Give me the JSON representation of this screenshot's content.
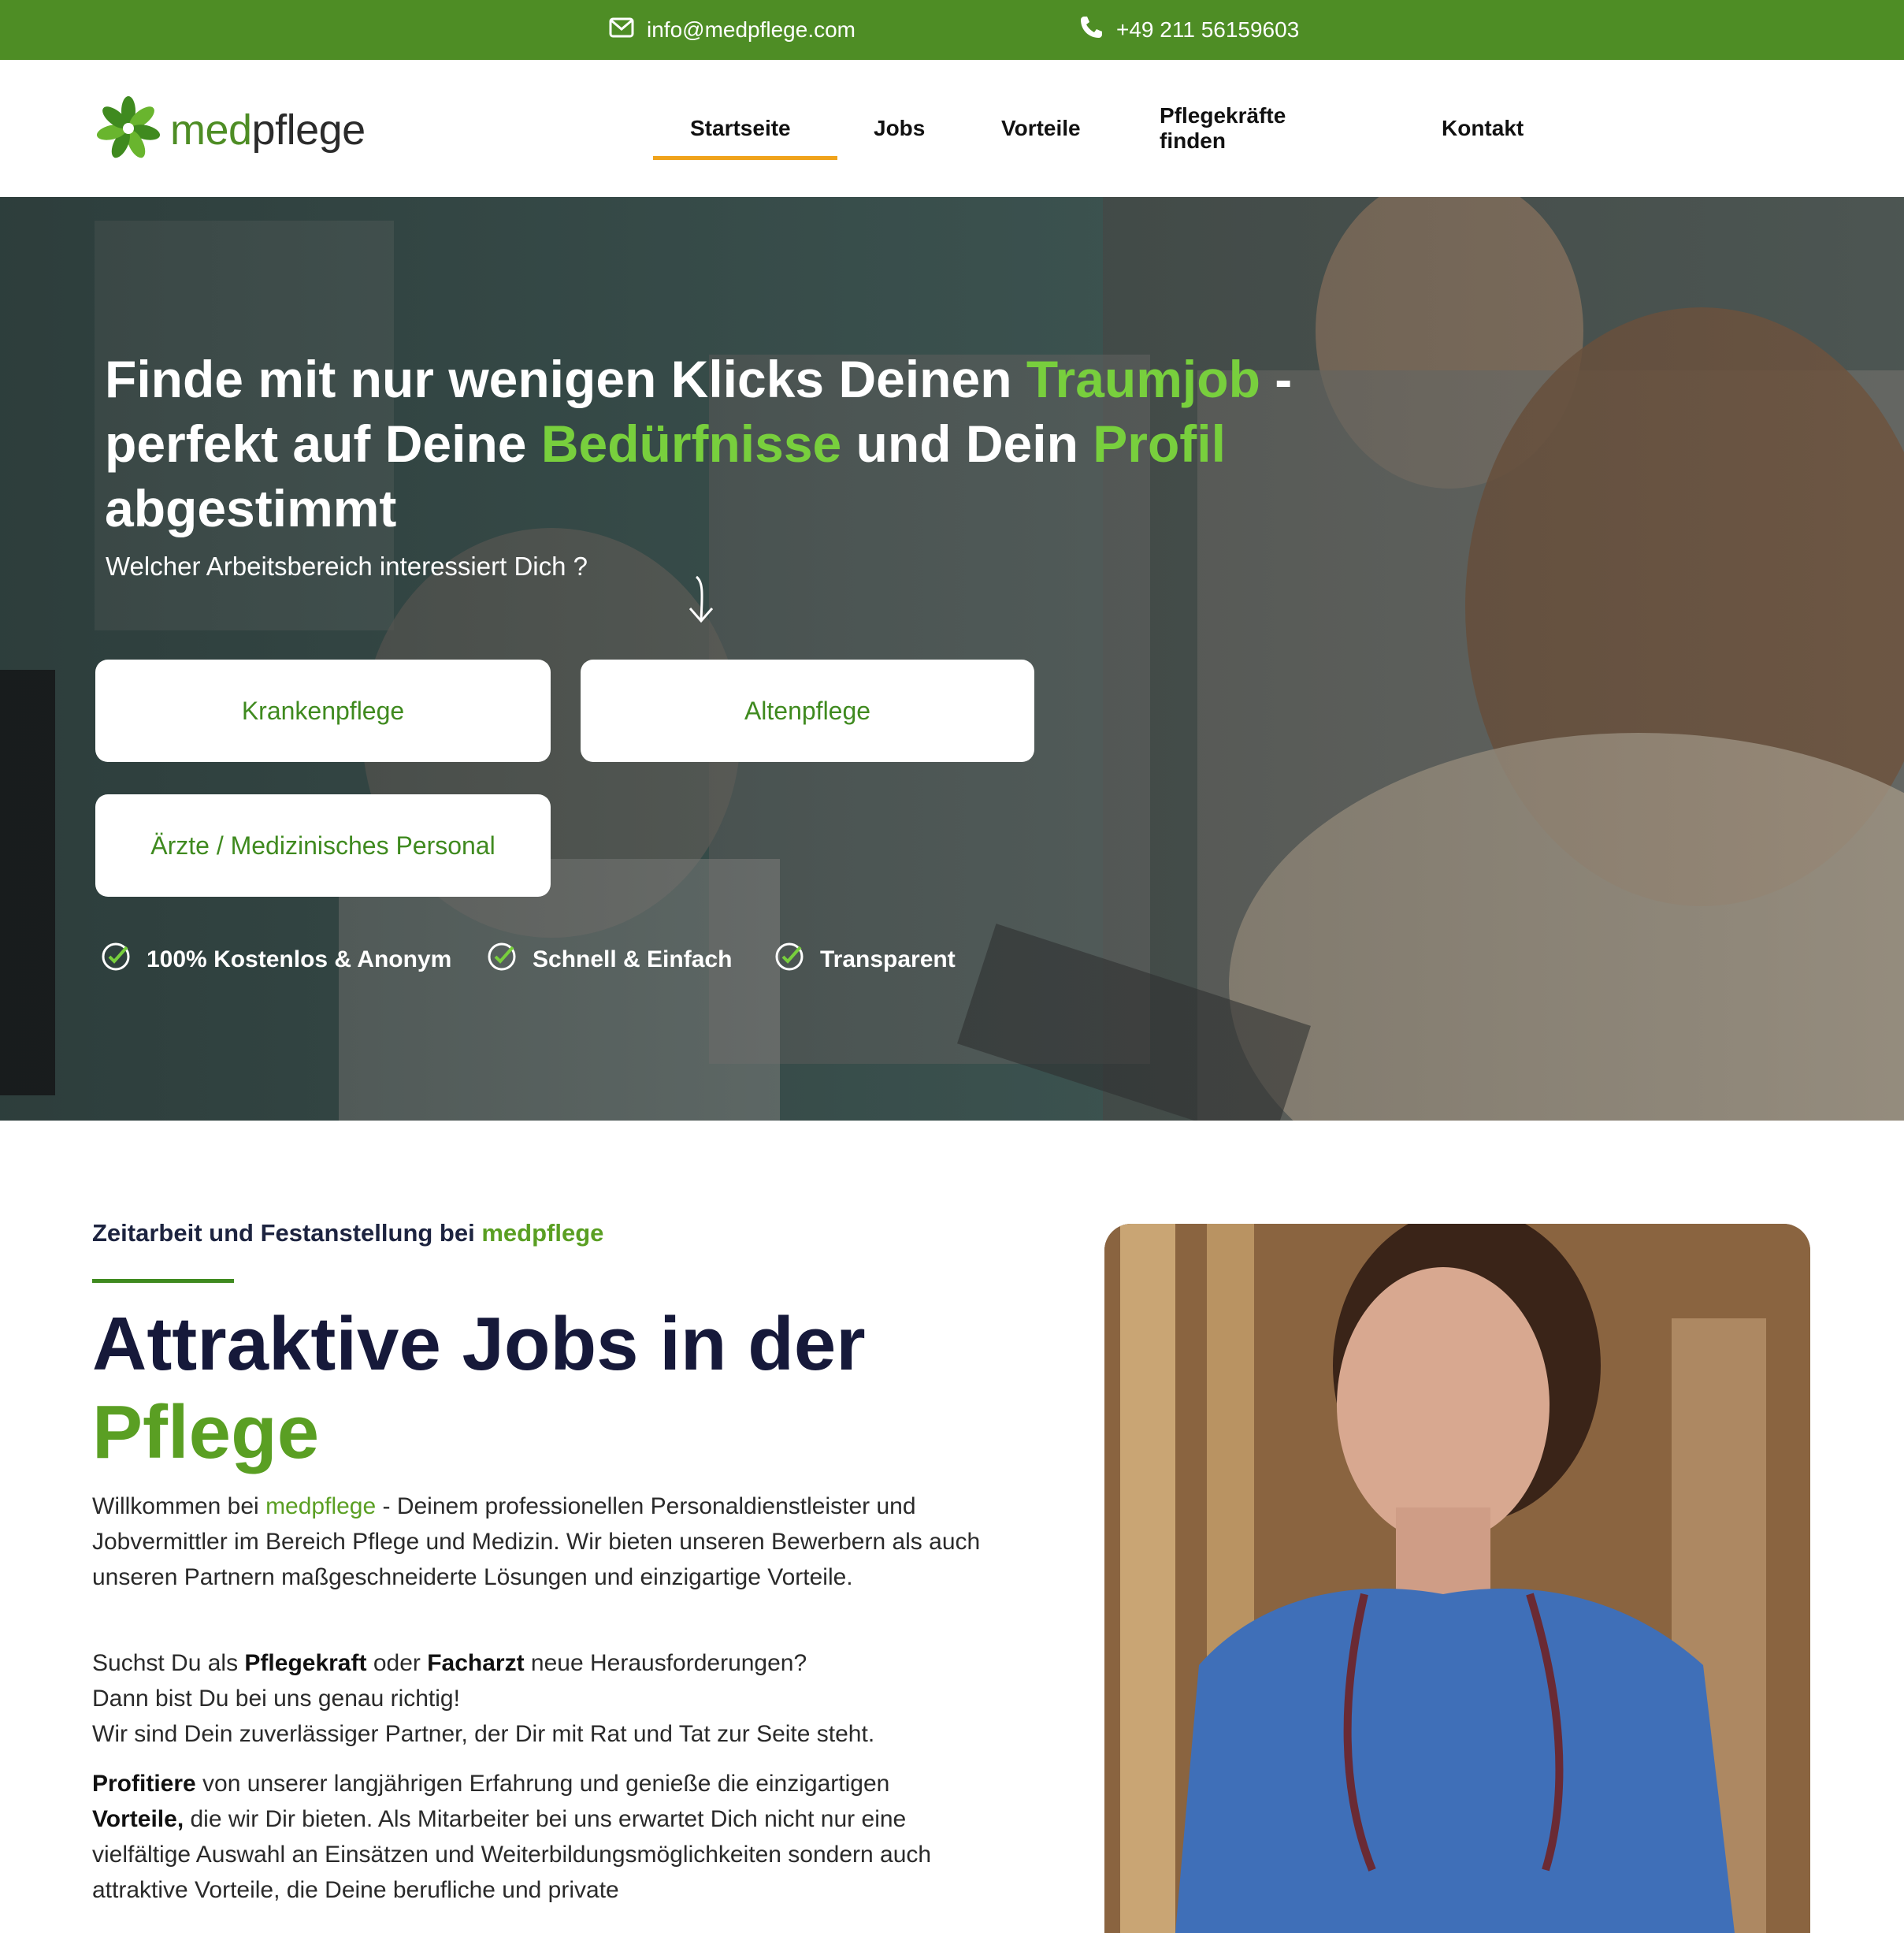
{
  "topbar": {
    "email": "info@medpflege.com",
    "phone": "+49 211 56159603"
  },
  "header": {
    "logo_prefix": "med",
    "logo_suffix": "pflege",
    "nav": [
      {
        "label": "Startseite",
        "active": true
      },
      {
        "label": "Jobs"
      },
      {
        "label": "Vorteile"
      },
      {
        "label": "Pflegekräfte finden"
      },
      {
        "label": "Kontakt"
      }
    ]
  },
  "hero": {
    "headline": {
      "p1": "Finde mit nur wenigen Klicks Deinen ",
      "hl1": "Traumjob",
      "p2": " - perfekt auf Deine ",
      "hl2": "Bedürfnisse",
      "p3": " und Dein ",
      "hl3": "Profil",
      "p4": " abgestimmt"
    },
    "subtitle": "Welcher Arbeitsbereich interessiert Dich ?",
    "categories": [
      "Krankenpflege",
      "Altenpflege",
      "Ärzte / Medizinisches Personal"
    ],
    "features": [
      "100% Kostenlos & Anonym",
      "Schnell & Einfach",
      "Transparent"
    ]
  },
  "content": {
    "eyebrow_prefix": "Zeitarbeit und Festanstellung bei ",
    "eyebrow_brand": "medpflege",
    "title_line1": "Attraktive Jobs in der",
    "title_line2": "Pflege",
    "p1": {
      "a": "Willkommen bei ",
      "brand": "medpflege",
      "b": " - Deinem professionellen Personaldienstleister und Jobvermittler im Bereich Pflege und Medizin. Wir bieten unseren Bewerbern als auch unseren Partnern maßgeschneiderte Lösungen und einzigartige Vorteile."
    },
    "p2": {
      "a": "Suchst Du als ",
      "b1": "Pflegekraft",
      "c": " oder ",
      "b2": "Facharzt",
      "d": " neue Herausforderungen?",
      "line2": "Dann bist Du bei uns genau richtig!",
      "line3": "Wir sind Dein zuverlässiger Partner, der Dir mit Rat und Tat zur Seite steht."
    },
    "p3": {
      "b1": "Profitiere",
      "a": " von unserer langjährigen Erfahrung und genieße die einzigartigen ",
      "b2": "Vorteile,",
      "c": " die wir Dir bieten. Als Mitarbeiter bei uns erwartet Dich nicht nur eine vielfältige Auswahl an Einsätzen und Weiterbildungsmöglichkeiten sondern auch attraktive Vorteile, die Deine berufliche und private"
    }
  },
  "colors": {
    "brand_green": "#4e8d25",
    "highlight_green": "#78cf3d",
    "accent_orange": "#f0a31b",
    "navy": "#16193a"
  },
  "icons": [
    "mail-icon",
    "phone-icon",
    "logo-flower-icon",
    "arrow-down-icon",
    "check-circle-icon"
  ]
}
